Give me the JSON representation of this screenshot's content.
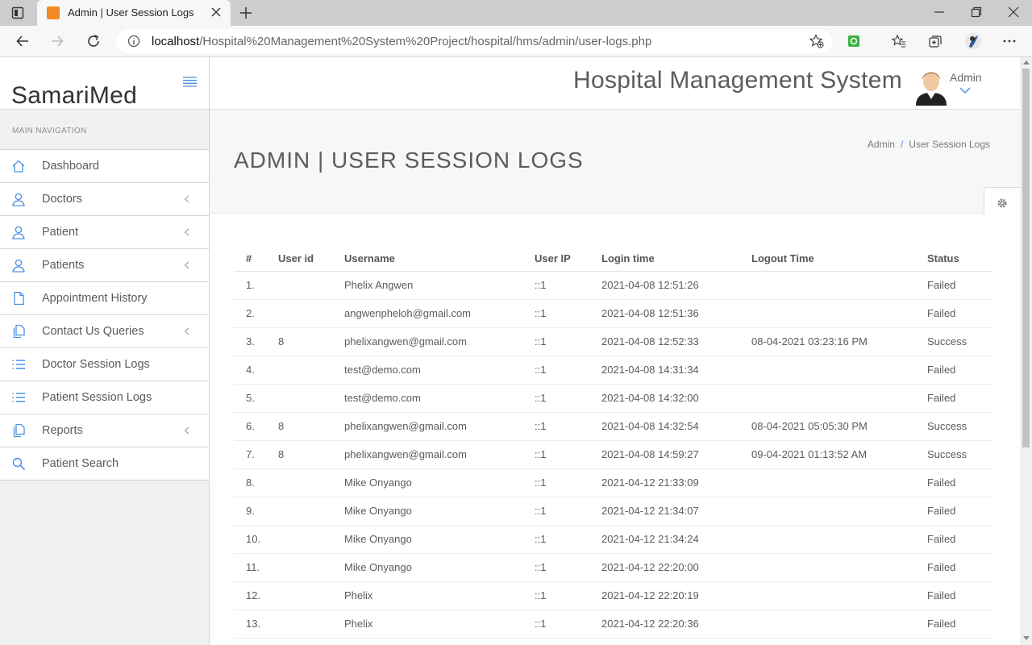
{
  "browser": {
    "tab_title": "Admin | User Session Logs",
    "url_host": "localhost",
    "url_path": "/Hospital%20Management%20System%20Project/hospital/hms/admin/user-logs.php"
  },
  "sidebar": {
    "brand": "SamariMed",
    "nav_header": "MAIN NAVIGATION",
    "items": [
      {
        "label": "Dashboard",
        "icon": "home-icon",
        "has_arrow": false
      },
      {
        "label": "Doctors",
        "icon": "user-icon",
        "has_arrow": true
      },
      {
        "label": "Patient",
        "icon": "user-icon",
        "has_arrow": true
      },
      {
        "label": "Patients",
        "icon": "user-icon",
        "has_arrow": true
      },
      {
        "label": "Appointment History",
        "icon": "file-icon",
        "has_arrow": false
      },
      {
        "label": "Contact Us Queries",
        "icon": "files-icon",
        "has_arrow": true
      },
      {
        "label": "Doctor Session Logs",
        "icon": "list-icon",
        "has_arrow": false
      },
      {
        "label": "Patient Session Logs",
        "icon": "list-icon",
        "has_arrow": false
      },
      {
        "label": "Reports",
        "icon": "files-icon",
        "has_arrow": true
      },
      {
        "label": "Patient Search",
        "icon": "search-icon",
        "has_arrow": false
      }
    ]
  },
  "header": {
    "system_title": "Hospital Management System",
    "user_label": "Admin"
  },
  "page": {
    "title": "ADMIN | USER SESSION LOGS",
    "breadcrumb": [
      "Admin",
      "User Session Logs"
    ]
  },
  "table": {
    "columns": [
      "#",
      "User id",
      "Username",
      "User IP",
      "Login time",
      "Logout Time",
      "Status"
    ],
    "rows": [
      [
        "1.",
        "",
        "Phelix Angwen",
        "::1",
        "2021-04-08 12:51:26",
        "",
        "Failed"
      ],
      [
        "2.",
        "",
        "angwenpheloh@gmail.com",
        "::1",
        "2021-04-08 12:51:36",
        "",
        "Failed"
      ],
      [
        "3.",
        "8",
        "phelixangwen@gmail.com",
        "::1",
        "2021-04-08 12:52:33",
        "08-04-2021 03:23:16 PM",
        "Success"
      ],
      [
        "4.",
        "",
        "test@demo.com",
        "::1",
        "2021-04-08 14:31:34",
        "",
        "Failed"
      ],
      [
        "5.",
        "",
        "test@demo.com",
        "::1",
        "2021-04-08 14:32:00",
        "",
        "Failed"
      ],
      [
        "6.",
        "8",
        "phelixangwen@gmail.com",
        "::1",
        "2021-04-08 14:32:54",
        "08-04-2021 05:05:30 PM",
        "Success"
      ],
      [
        "7.",
        "8",
        "phelixangwen@gmail.com",
        "::1",
        "2021-04-08 14:59:27",
        "09-04-2021 01:13:52 AM",
        "Success"
      ],
      [
        "8.",
        "",
        "Mike Onyango",
        "::1",
        "2021-04-12 21:33:09",
        "",
        "Failed"
      ],
      [
        "9.",
        "",
        "Mike Onyango",
        "::1",
        "2021-04-12 21:34:07",
        "",
        "Failed"
      ],
      [
        "10.",
        "",
        "Mike Onyango",
        "::1",
        "2021-04-12 21:34:24",
        "",
        "Failed"
      ],
      [
        "11.",
        "",
        "Mike Onyango",
        "::1",
        "2021-04-12 22:20:00",
        "",
        "Failed"
      ],
      [
        "12.",
        "",
        "Phelix",
        "::1",
        "2021-04-12 22:20:19",
        "",
        "Failed"
      ],
      [
        "13.",
        "",
        "Phelix",
        "::1",
        "2021-04-12 22:20:36",
        "",
        "Failed"
      ]
    ]
  },
  "colors": {
    "accent": "#4a90e2",
    "sidebar_bg": "#f1f1f2",
    "text": "#5b5b60"
  }
}
